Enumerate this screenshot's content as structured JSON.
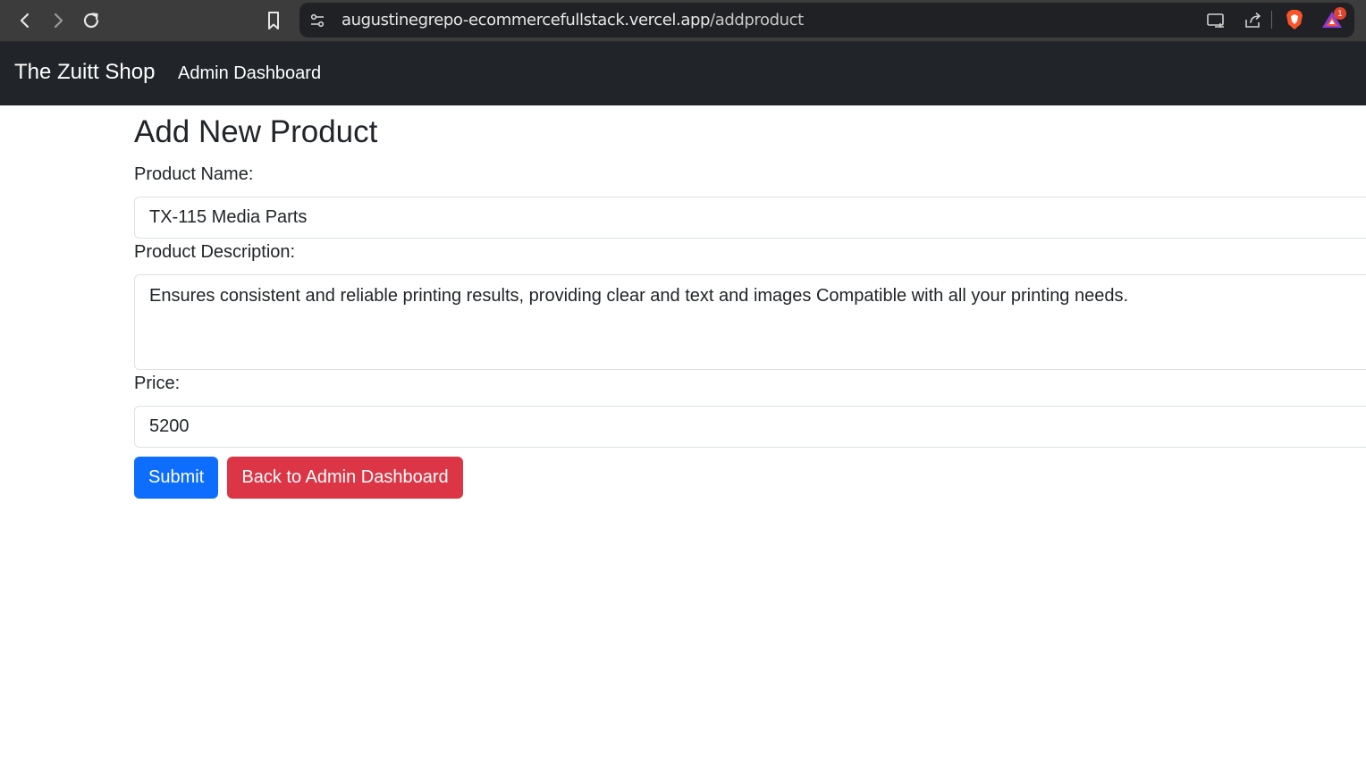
{
  "browser": {
    "url_host": "augustinegrepo-ecommercefullstack.vercel.app",
    "url_path": "/addproduct",
    "icons": [
      "back-icon",
      "forward-icon",
      "reload-icon",
      "bookmark-icon",
      "site-settings-icon",
      "cast-icon",
      "share-icon",
      "brave-shield-icon",
      "brave-rewards-icon"
    ],
    "rewards_badge": "1"
  },
  "navbar": {
    "brand": "The Zuitt Shop",
    "link": "Admin Dashboard"
  },
  "page": {
    "title": "Add New Product"
  },
  "form": {
    "name_label": "Product Name:",
    "name_value": "TX-115 Media Parts",
    "description_label": "Product Description:",
    "description_value": "Ensures consistent and reliable printing results, providing clear and text and images Compatible with all your printing needs.",
    "price_label": "Price:",
    "price_value": "5200",
    "submit_label": "Submit",
    "back_label": "Back to Admin Dashboard"
  },
  "colors": {
    "navbar_bg": "#212529",
    "primary": "#0d6efd",
    "danger": "#dc3545",
    "text": "#212529"
  }
}
